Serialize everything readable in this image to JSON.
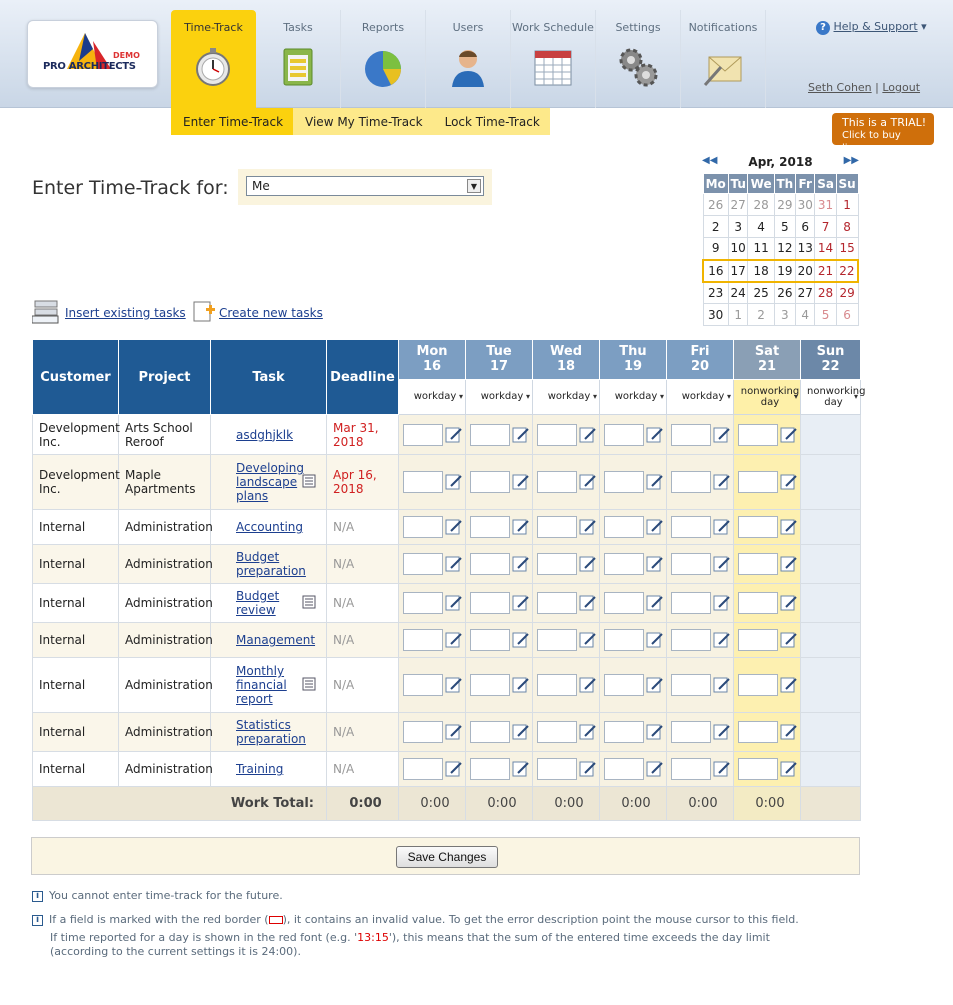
{
  "app": {
    "logo_text": "PRO ARCHITECTS",
    "logo_badge": "DEMO"
  },
  "nav": {
    "tabs": [
      {
        "label": "Time-Track",
        "icon": "stopwatch-icon"
      },
      {
        "label": "Tasks",
        "icon": "clipboard-icon"
      },
      {
        "label": "Reports",
        "icon": "pie-chart-icon"
      },
      {
        "label": "Users",
        "icon": "user-icon"
      },
      {
        "label": "Work Schedule",
        "icon": "calendar-icon"
      },
      {
        "label": "Settings",
        "icon": "gears-icon"
      },
      {
        "label": "Notifications",
        "icon": "envelope-icon"
      }
    ],
    "subtabs": [
      "Enter Time-Track",
      "View My Time-Track",
      "Lock Time-Track"
    ]
  },
  "header": {
    "help": "Help & Support",
    "user": "Seth Cohen",
    "logout": "Logout",
    "trial_line1": "This is a TRIAL!",
    "trial_line2": "Click to buy license"
  },
  "form": {
    "title": "Enter Time-Track for:",
    "user_select": "Me"
  },
  "calendar": {
    "month": "Apr, 2018",
    "days": [
      "Mo",
      "Tu",
      "We",
      "Th",
      "Fr",
      "Sa",
      "Su"
    ],
    "weeks": [
      [
        "26",
        "27",
        "28",
        "29",
        "30",
        "31",
        "1"
      ],
      [
        "2",
        "3",
        "4",
        "5",
        "6",
        "7",
        "8"
      ],
      [
        "9",
        "10",
        "11",
        "12",
        "13",
        "14",
        "15"
      ],
      [
        "16",
        "17",
        "18",
        "19",
        "20",
        "21",
        "22"
      ],
      [
        "23",
        "24",
        "25",
        "26",
        "27",
        "28",
        "29"
      ],
      [
        "30",
        "1",
        "2",
        "3",
        "4",
        "5",
        "6"
      ]
    ]
  },
  "links": {
    "insert": "Insert existing tasks",
    "create": "Create new tasks"
  },
  "grid": {
    "headers": [
      "Customer",
      "Project",
      "Task",
      "Deadline"
    ],
    "days": [
      {
        "name": "Mon",
        "num": "16",
        "type": "workday"
      },
      {
        "name": "Tue",
        "num": "17",
        "type": "workday"
      },
      {
        "name": "Wed",
        "num": "18",
        "type": "workday"
      },
      {
        "name": "Thu",
        "num": "19",
        "type": "workday"
      },
      {
        "name": "Fri",
        "num": "20",
        "type": "workday"
      },
      {
        "name": "Sat",
        "num": "21",
        "type": "nonworking day"
      },
      {
        "name": "Sun",
        "num": "22",
        "type": "nonworking day"
      }
    ],
    "rows": [
      {
        "customer": "Development Inc.",
        "project": "Arts School Reroof",
        "task": "asdghjklk",
        "deadline": "Mar 31, 2018",
        "note": false
      },
      {
        "customer": "Development Inc.",
        "project": "Maple Apartments",
        "task": "Developing landscape plans",
        "deadline": "Apr 16, 2018",
        "note": true
      },
      {
        "customer": "Internal",
        "project": "Administration",
        "task": "Accounting",
        "deadline": "N/A",
        "note": false
      },
      {
        "customer": "Internal",
        "project": "Administration",
        "task": "Budget preparation",
        "deadline": "N/A",
        "note": false
      },
      {
        "customer": "Internal",
        "project": "Administration",
        "task": "Budget review",
        "deadline": "N/A",
        "note": true
      },
      {
        "customer": "Internal",
        "project": "Administration",
        "task": "Management",
        "deadline": "N/A",
        "note": false
      },
      {
        "customer": "Internal",
        "project": "Administration",
        "task": "Monthly financial report",
        "deadline": "N/A",
        "note": true
      },
      {
        "customer": "Internal",
        "project": "Administration",
        "task": "Statistics preparation",
        "deadline": "N/A",
        "note": false
      },
      {
        "customer": "Internal",
        "project": "Administration",
        "task": "Training",
        "deadline": "N/A",
        "note": false
      }
    ],
    "total_label": "Work Total:",
    "total": "0:00",
    "day_totals": [
      "0:00",
      "0:00",
      "0:00",
      "0:00",
      "0:00",
      "0:00"
    ]
  },
  "save_label": "Save Changes",
  "notes": {
    "n1": "You cannot enter time-track for the future.",
    "n2a": "If a field is marked with the red border (",
    "n2b": "), it contains an invalid value. To get the error description point the mouse cursor to this field.",
    "n3a": "If time reported for a day is shown in the red font (e.g. '",
    "n3ex": "13:15",
    "n3b": "'), this means that the sum of the entered time exceeds the day limit",
    "n3c": "(according to the current settings it is 24:00)."
  }
}
